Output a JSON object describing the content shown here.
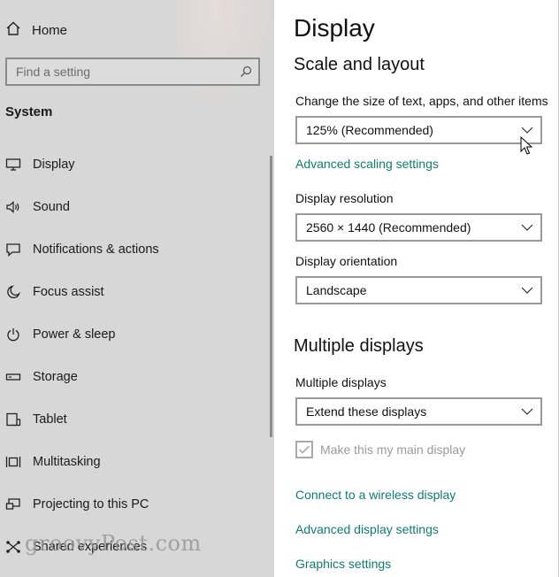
{
  "sidebar": {
    "home_label": "Home",
    "search": {
      "placeholder": "Find a setting"
    },
    "section_title": "System",
    "items": [
      {
        "label": "Display",
        "icon": "monitor-icon"
      },
      {
        "label": "Sound",
        "icon": "speaker-icon"
      },
      {
        "label": "Notifications & actions",
        "icon": "notification-icon"
      },
      {
        "label": "Focus assist",
        "icon": "moon-icon"
      },
      {
        "label": "Power & sleep",
        "icon": "power-icon"
      },
      {
        "label": "Storage",
        "icon": "storage-icon"
      },
      {
        "label": "Tablet",
        "icon": "tablet-icon"
      },
      {
        "label": "Multitasking",
        "icon": "multitasking-icon"
      },
      {
        "label": "Projecting to this PC",
        "icon": "projecting-icon"
      },
      {
        "label": "Shared experiences",
        "icon": "shared-experiences-icon"
      }
    ],
    "watermark": "groovyPost.com"
  },
  "main": {
    "title": "Display",
    "scale_layout": {
      "heading": "Scale and layout",
      "scale_label": "Change the size of text, apps, and other items",
      "scale_value": "125% (Recommended)",
      "advanced_scaling_link": "Advanced scaling settings",
      "resolution_label": "Display resolution",
      "resolution_value": "2560 × 1440 (Recommended)",
      "orientation_label": "Display orientation",
      "orientation_value": "Landscape"
    },
    "multiple_displays": {
      "heading": "Multiple displays",
      "label": "Multiple displays",
      "value": "Extend these displays",
      "main_display_checkbox": "Make this my main display",
      "main_display_checked": true,
      "wireless_link": "Connect to a wireless display",
      "advanced_display_link": "Advanced display settings",
      "graphics_link": "Graphics settings"
    }
  },
  "colors": {
    "accent_link": "#107c6e",
    "sidebar_bg": "#d7d7d7",
    "content_bg": "#ffffff"
  }
}
